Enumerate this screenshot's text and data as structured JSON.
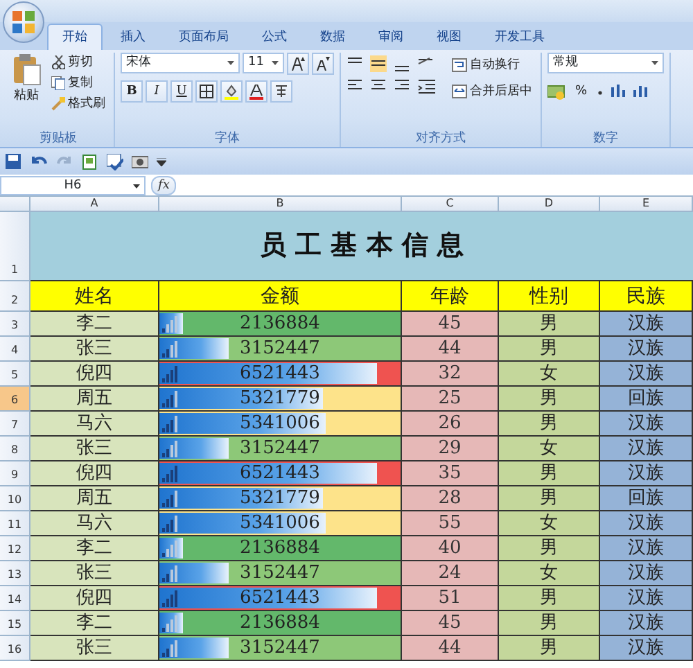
{
  "tabs": [
    {
      "label": "开始",
      "selected": true
    },
    {
      "label": "插入",
      "selected": false
    },
    {
      "label": "页面布局",
      "selected": false
    },
    {
      "label": "公式",
      "selected": false
    },
    {
      "label": "数据",
      "selected": false
    },
    {
      "label": "审阅",
      "selected": false
    },
    {
      "label": "视图",
      "selected": false
    },
    {
      "label": "开发工具",
      "selected": false
    }
  ],
  "ribbon": {
    "clipboard": {
      "label": "剪贴板",
      "paste": "粘贴",
      "cut": "剪切",
      "copy": "复制",
      "format_painter": "格式刷"
    },
    "font": {
      "label": "字体",
      "font_name": "宋体",
      "font_size": "11",
      "bold": "B",
      "italic": "I",
      "underline": "U"
    },
    "alignment": {
      "label": "对齐方式",
      "wrap_text": "自动换行",
      "merge_center": "合并后居中"
    },
    "number": {
      "label": "数字",
      "format": "常规",
      "percent": "%"
    }
  },
  "formula_bar": {
    "name_box": "H6",
    "fx": "fx"
  },
  "columns": [
    "A",
    "B",
    "C",
    "D",
    "E"
  ],
  "sheet": {
    "title_row": "1",
    "title": "员 工 基 本 信 息",
    "header_row": "2",
    "header": [
      "姓名",
      "金额",
      "年龄",
      "性别",
      "民族"
    ],
    "rows": [
      {
        "number": "3",
        "selected": false,
        "name": "李二",
        "amount": "2136884",
        "level": 0.1,
        "color": "#63b86b",
        "age": "45",
        "gender": "男",
        "ethnicity": "汉族"
      },
      {
        "number": "4",
        "selected": false,
        "name": "张三",
        "amount": "3152447",
        "level": 0.29,
        "color": "#8dc878",
        "age": "44",
        "gender": "男",
        "ethnicity": "汉族"
      },
      {
        "number": "5",
        "selected": false,
        "name": "倪四",
        "amount": "6521443",
        "level": 0.9,
        "color": "#ef5350",
        "age": "32",
        "gender": "女",
        "ethnicity": "汉族"
      },
      {
        "number": "6",
        "selected": true,
        "name": "周五",
        "amount": "5321779",
        "level": 0.68,
        "color": "#fde38a",
        "age": "25",
        "gender": "男",
        "ethnicity": "回族"
      },
      {
        "number": "7",
        "selected": false,
        "name": "马六",
        "amount": "5341006",
        "level": 0.69,
        "color": "#fde38a",
        "age": "26",
        "gender": "男",
        "ethnicity": "汉族"
      },
      {
        "number": "8",
        "selected": false,
        "name": "张三",
        "amount": "3152447",
        "level": 0.29,
        "color": "#8dc878",
        "age": "29",
        "gender": "女",
        "ethnicity": "汉族"
      },
      {
        "number": "9",
        "selected": false,
        "name": "倪四",
        "amount": "6521443",
        "level": 0.9,
        "color": "#ef5350",
        "age": "35",
        "gender": "男",
        "ethnicity": "汉族"
      },
      {
        "number": "10",
        "selected": false,
        "name": "周五",
        "amount": "5321779",
        "level": 0.68,
        "color": "#fde38a",
        "age": "28",
        "gender": "男",
        "ethnicity": "回族"
      },
      {
        "number": "11",
        "selected": false,
        "name": "马六",
        "amount": "5341006",
        "level": 0.69,
        "color": "#fde38a",
        "age": "55",
        "gender": "女",
        "ethnicity": "汉族"
      },
      {
        "number": "12",
        "selected": false,
        "name": "李二",
        "amount": "2136884",
        "level": 0.1,
        "color": "#63b86b",
        "age": "40",
        "gender": "男",
        "ethnicity": "汉族"
      },
      {
        "number": "13",
        "selected": false,
        "name": "张三",
        "amount": "3152447",
        "level": 0.29,
        "color": "#8dc878",
        "age": "24",
        "gender": "女",
        "ethnicity": "汉族"
      },
      {
        "number": "14",
        "selected": false,
        "name": "倪四",
        "amount": "6521443",
        "level": 0.9,
        "color": "#ef5350",
        "age": "51",
        "gender": "男",
        "ethnicity": "汉族"
      },
      {
        "number": "15",
        "selected": false,
        "name": "李二",
        "amount": "2136884",
        "level": 0.1,
        "color": "#63b86b",
        "age": "45",
        "gender": "男",
        "ethnicity": "汉族"
      },
      {
        "number": "16",
        "selected": false,
        "name": "张三",
        "amount": "3152447",
        "level": 0.29,
        "color": "#8dc878",
        "age": "44",
        "gender": "男",
        "ethnicity": "汉族"
      }
    ]
  }
}
